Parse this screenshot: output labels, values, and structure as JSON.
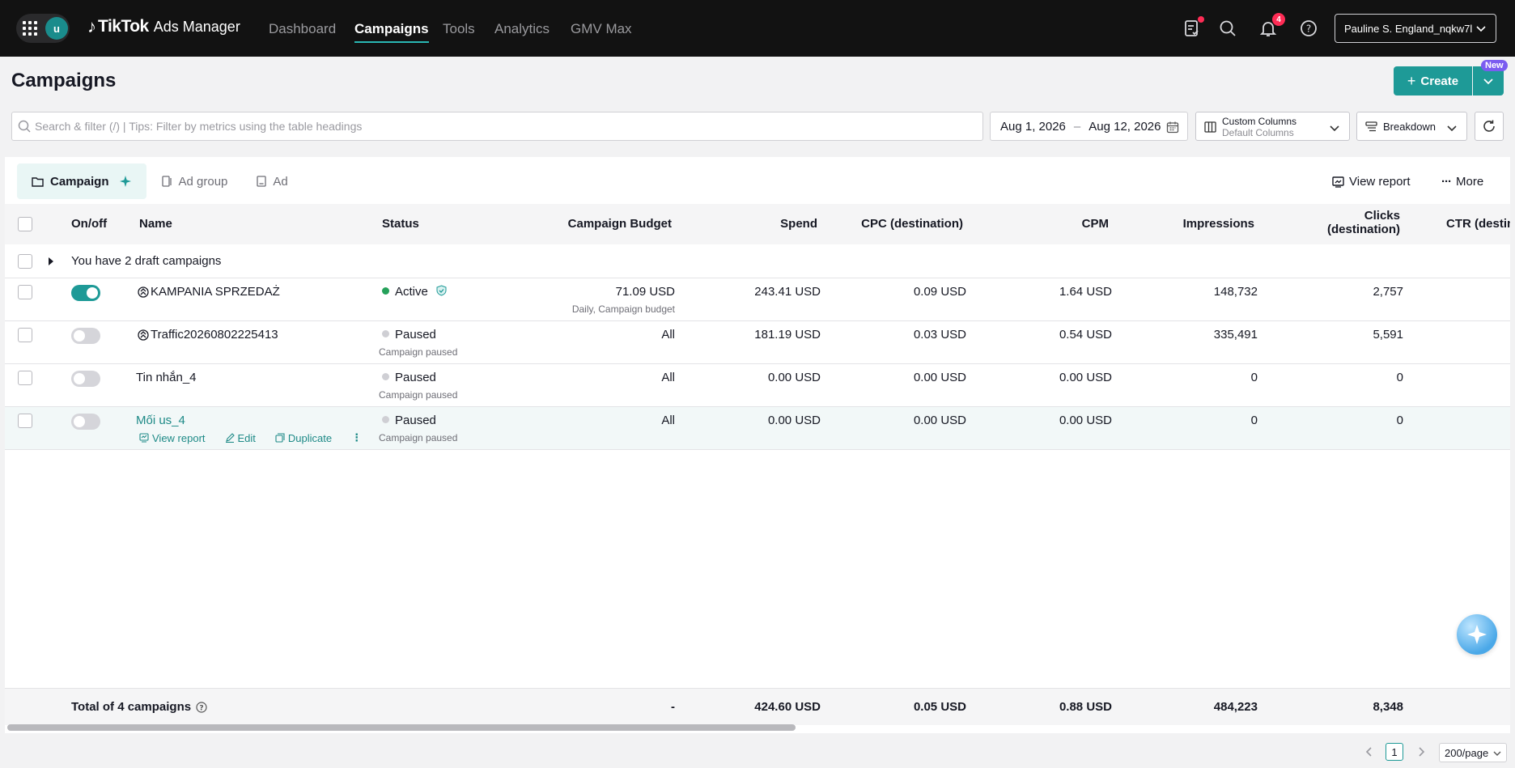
{
  "nav": {
    "avatar_letter": "u",
    "logo_brand": "TikTok",
    "logo_sub": "Ads Manager",
    "links": [
      "Dashboard",
      "Campaigns",
      "Tools",
      "Analytics",
      "GMV Max"
    ],
    "active_link": "Campaigns",
    "notification_count": "4",
    "account_name": "Pauline S. England_nqkw7l"
  },
  "header": {
    "title": "Campaigns",
    "create_label": "Create",
    "new_badge": "New"
  },
  "filters": {
    "search_placeholder": "Search & filter (/) | Tips: Filter by metrics using the table headings",
    "date_start": "Aug 1, 2026",
    "date_sep": "–",
    "date_end": "Aug 12, 2026",
    "custom_columns_label": "Custom Columns",
    "custom_columns_value": "Default Columns",
    "breakdown_label": "Breakdown"
  },
  "level_tabs": [
    "Campaign",
    "Ad group",
    "Ad"
  ],
  "toolbar": {
    "view_report": "View report",
    "more": "More"
  },
  "table": {
    "headers": {
      "onoff": "On/off",
      "name": "Name",
      "status": "Status",
      "budget": "Campaign Budget",
      "spend": "Spend",
      "cpc": "CPC (destination)",
      "cpm": "CPM",
      "impressions": "Impressions",
      "clicks_line1": "Clicks",
      "clicks_line2": "(destination)",
      "ctr": "CTR (destin"
    },
    "draft_row": "You have 2 draft campaigns",
    "rows": [
      {
        "on": true,
        "name": "KAMPANIA SPRZEDAŻ",
        "status": "Active",
        "status_sub": "",
        "budget": "71.09 USD",
        "budget_sub": "Daily, Campaign budget",
        "spend": "243.41 USD",
        "cpc": "0.09 USD",
        "cpm": "1.64 USD",
        "impressions": "148,732",
        "clicks": "2,757"
      },
      {
        "on": false,
        "name": "Traffic20260802225413",
        "status": "Paused",
        "status_sub": "Campaign paused",
        "budget": "All",
        "budget_sub": "",
        "spend": "181.19 USD",
        "cpc": "0.03 USD",
        "cpm": "0.54 USD",
        "impressions": "335,491",
        "clicks": "5,591"
      },
      {
        "on": false,
        "name": "Tin nhắn_4",
        "status": "Paused",
        "status_sub": "Campaign paused",
        "budget": "All",
        "budget_sub": "",
        "spend": "0.00 USD",
        "cpc": "0.00 USD",
        "cpm": "0.00 USD",
        "impressions": "0",
        "clicks": "0"
      },
      {
        "on": false,
        "name": "Mối us_4",
        "status": "Paused",
        "status_sub": "Campaign paused",
        "budget": "All",
        "budget_sub": "",
        "spend": "0.00 USD",
        "cpc": "0.00 USD",
        "cpm": "0.00 USD",
        "impressions": "0",
        "clicks": "0"
      }
    ],
    "row_actions": {
      "view_report": "View report",
      "edit": "Edit",
      "duplicate": "Duplicate"
    },
    "total": {
      "label": "Total of 4 campaigns",
      "budget": "-",
      "spend": "424.60 USD",
      "cpc": "0.05 USD",
      "cpm": "0.88 USD",
      "impressions": "484,223",
      "clicks": "8,348"
    }
  },
  "pagination": {
    "current_page": "1",
    "page_size": "200/page"
  },
  "colors": {
    "accent": "#1e9a97",
    "active_status": "#25a15a",
    "badge_red": "#fe2c55",
    "new_badge": "#7b5cf0"
  }
}
